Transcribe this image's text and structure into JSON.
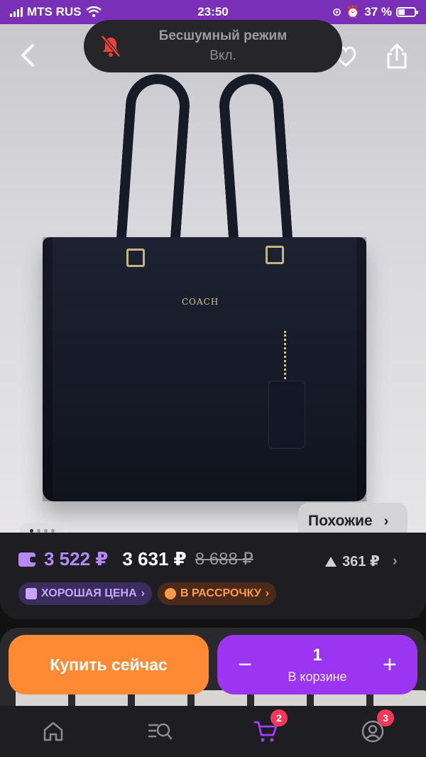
{
  "status_bar": {
    "carrier": "MTS RUS",
    "time": "23:50",
    "battery": "37 %"
  },
  "toast": {
    "title": "Бесшумный режим",
    "subtitle": "Вкл."
  },
  "hero": {
    "image_label": "COACH",
    "similar_label": "Похожие",
    "gallery_index": 1,
    "gallery_count": 4
  },
  "price": {
    "wallet_price": "3 522 ₽",
    "price": "3 631 ₽",
    "old_price": "8 688 ₽",
    "price_drop": "361 ₽"
  },
  "chips": {
    "good_price": "ХОРОШАЯ ЦЕНА",
    "installment": "В РАССРОЧКУ"
  },
  "actions": {
    "buy_now": "Купить сейчас",
    "cart_qty": "1",
    "cart_label": "В корзине",
    "minus": "−",
    "plus": "+"
  },
  "tabbar": {
    "cart_badge": "2",
    "profile_badge": "3"
  },
  "colors": {
    "accent_purple": "#9b35f2",
    "accent_orange": "#ff8a34",
    "status_bar": "#7a2fb8"
  }
}
